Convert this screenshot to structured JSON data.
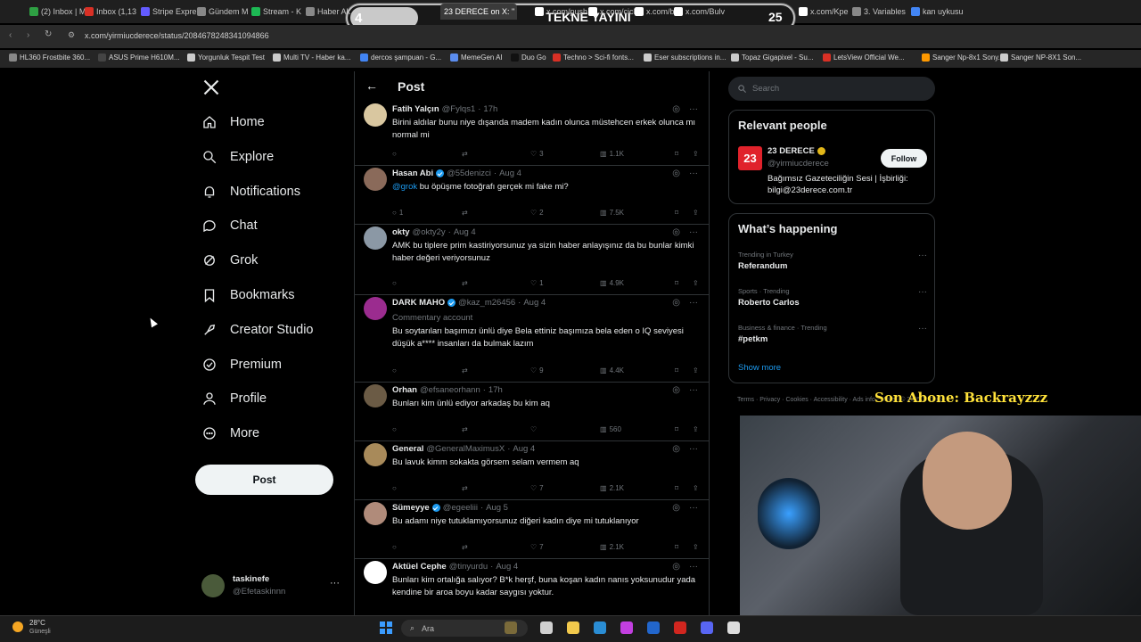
{
  "browser": {
    "tabs": [
      {
        "label": "(2) Inbox | M",
        "color": "#2ea043"
      },
      {
        "label": "Inbox (1,13",
        "color": "#d93025"
      },
      {
        "label": "Stripe Expre",
        "color": "#635bff"
      },
      {
        "label": "Gündem M",
        "color": "#888888"
      },
      {
        "label": "Stream - K",
        "color": "#1db954"
      },
      {
        "label": "Haber Ak",
        "color": "#888888"
      },
      {
        "label": "23 DERECE on X: \"",
        "color": "#ffffff"
      },
      {
        "label": "x.com/push",
        "color": "#ffffff"
      },
      {
        "label": "x.com/cick",
        "color": "#ffffff"
      },
      {
        "label": "x.com/bo",
        "color": "#ffffff"
      },
      {
        "label": "x.com/Bulv",
        "color": "#ffffff"
      },
      {
        "label": "x.com/Kpe",
        "color": "#ffffff"
      },
      {
        "label": "3. Variables",
        "color": "#888888"
      },
      {
        "label": "kan uykusu",
        "color": "#4285f4"
      }
    ],
    "url": "x.com/yirmiucderece/status/2084678248341094866",
    "bookmarks": [
      {
        "label": "HL360 Frostbite 360...",
        "color": "#888888"
      },
      {
        "label": "ASUS Prime H610M...",
        "color": "#444444"
      },
      {
        "label": "Yorgunluk Tespit Test",
        "color": "#cccccc"
      },
      {
        "label": "Multi TV - Haber ka...",
        "color": "#cccccc"
      },
      {
        "label": "dercos şampuan - G...",
        "color": "#4285f4"
      },
      {
        "label": "MemeGen AI",
        "color": "#5b8def"
      },
      {
        "label": "Duo Go",
        "color": "#111111"
      },
      {
        "label": "Techno > Sci-fi fonts...",
        "color": "#d93025"
      },
      {
        "label": "Eser subscriptions in...",
        "color": "#cccccc"
      },
      {
        "label": "Topaz Gigapixel - Su...",
        "color": "#cccccc"
      },
      {
        "label": "LetsView Official We...",
        "color": "#d93025"
      },
      {
        "label": "Sanger Np-8x1 Sony...",
        "color": "#ff9900"
      },
      {
        "label": "Sanger NP-8X1 Son...",
        "color": "#cccccc"
      }
    ]
  },
  "stream_overlay": {
    "left_count": "4",
    "title": "TEKNE YAYINI",
    "right_count": "25",
    "watermark": "Son Abone: Backrayzzz"
  },
  "nav": {
    "items": [
      {
        "label": "Home",
        "icon": "home-icon"
      },
      {
        "label": "Explore",
        "icon": "search-icon"
      },
      {
        "label": "Notifications",
        "icon": "bell-icon"
      },
      {
        "label": "Chat",
        "icon": "chat-icon"
      },
      {
        "label": "Grok",
        "icon": "grok-icon"
      },
      {
        "label": "Bookmarks",
        "icon": "bookmark-icon"
      },
      {
        "label": "Creator Studio",
        "icon": "rocket-icon"
      },
      {
        "label": "Premium",
        "icon": "premium-icon"
      },
      {
        "label": "Profile",
        "icon": "person-icon"
      },
      {
        "label": "More",
        "icon": "more-circle-icon"
      }
    ],
    "post_button": "Post",
    "user": {
      "name": "taskinefe",
      "handle": "@Efetaskinnn"
    }
  },
  "center": {
    "header_title": "Post",
    "replies": [
      {
        "name": "Fatih Yalçın",
        "handle": "@Fylqs1",
        "time": "17h",
        "verified": false,
        "badge": "",
        "text": "Birini aldılar bunu niye dışarıda madem kadın olunca müstehcen erkek olunca mı normal mi",
        "replies": "",
        "retweets": "",
        "likes": "3",
        "views": "1.1K",
        "avatar_color": "#d9c7a0"
      },
      {
        "name": "Hasan Abi",
        "handle": "@55denizci",
        "time": "Aug 4",
        "verified": true,
        "badge": "",
        "mention": "@grok",
        "text": " bu öpüşme fotoğrafı gerçek mi fake mi?",
        "replies": "1",
        "retweets": "",
        "likes": "2",
        "views": "7.5K",
        "avatar_color": "#8a6a5a"
      },
      {
        "name": "okty",
        "handle": "@okty2y",
        "time": "Aug 4",
        "verified": false,
        "badge": "",
        "text": "AMK bu tiplere prim kastiriyorsunuz ya sizin haber anlayışınız  da bu bunlar kimki haber değeri veriyorsunuz",
        "replies": "",
        "retweets": "",
        "likes": "1",
        "views": "4.9K",
        "avatar_color": "#8b98a5"
      },
      {
        "name": "DARK MAHO",
        "handle": "@kaz_m26456",
        "time": "Aug 4",
        "verified": true,
        "badge": "Commentary account",
        "text": "Bu soytarıları başımızı ünlü diye Bela ettiniz başımıza bela eden o IQ seviyesi düşük a**** insanları da bulmak lazım",
        "replies": "",
        "retweets": "",
        "likes": "9",
        "views": "4.4K",
        "avatar_color": "#9b2c8f"
      },
      {
        "name": "Orhan",
        "handle": "@efsaneorhann",
        "time": "17h",
        "verified": false,
        "badge": "",
        "text": "Bunları kim ünlü ediyor arkadaş bu kim aq",
        "replies": "",
        "retweets": "",
        "likes": "",
        "views": "560",
        "avatar_color": "#6b5b45"
      },
      {
        "name": "General",
        "handle": "@GeneralMaximusX",
        "time": "Aug 4",
        "verified": false,
        "badge": "",
        "text": "Bu lavuk kimm sokakta görsem selam vermem aq",
        "replies": "",
        "retweets": "",
        "likes": "7",
        "views": "2.1K",
        "avatar_color": "#a88a5a"
      },
      {
        "name": "Sümeyye",
        "handle": "@egeeliii",
        "time": "Aug 5",
        "verified": true,
        "badge": "",
        "text": "Bu adamı niye tutuklamıyorsunuz diğeri kadın diye mi tutuklanıyor",
        "replies": "",
        "retweets": "",
        "likes": "7",
        "views": "2.1K",
        "avatar_color": "#b08b7a"
      },
      {
        "name": "Aktüel Cephe",
        "handle": "@tinyurdu",
        "time": "Aug 4",
        "verified": false,
        "badge": "",
        "text": "Bunları kim ortalığa salıyor? B*k herşf, buna koşan kadın nanıs yoksunudur yada kendine bir aroa boyu kadar saygısı yoktur.",
        "replies": "",
        "retweets": "",
        "likes": "",
        "views": "",
        "avatar_color": "#ffffff"
      }
    ]
  },
  "right": {
    "search_placeholder": "Search",
    "relevant_title": "Relevant people",
    "person": {
      "name": "23 DERECE",
      "handle": "@yirmiucderece",
      "bio": "Bağımsız Gazeteciliğin Sesi | İşbirliği: bilgi@23derece.com.tr",
      "follow_label": "Follow",
      "logo_text": "23",
      "logo_color": "#e0222b"
    },
    "happening_title": "What’s happening",
    "trends": [
      {
        "context": "Trending in Turkey",
        "title": "Referandum"
      },
      {
        "context": "Sports · Trending",
        "title": "Roberto Carlos"
      },
      {
        "context": "Business & finance · Trending",
        "title": "#petkm"
      }
    ],
    "show_more": "Show more",
    "footer": "Terms  ·  Privacy  ·  Cookies  ·  Accessibility  ·  Ads info  ·  More  ·  © 2025 X Corp."
  },
  "taskbar": {
    "weather_temp": "28°C",
    "weather_desc": "Güneşli",
    "search_label": "Ara"
  }
}
